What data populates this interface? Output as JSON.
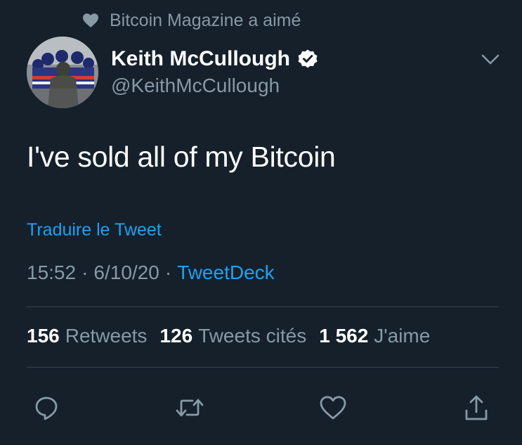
{
  "social_context": {
    "icon": "heart-icon",
    "text": "Bitcoin Magazine a aimé"
  },
  "author": {
    "name": "Keith McCullough",
    "handle": "@KeithMcCullough",
    "verified": true
  },
  "tweet": {
    "text": "I've sold all of my Bitcoin",
    "translate_label": "Traduire le Tweet",
    "time": "15:52",
    "separator": "·",
    "date": "6/10/20",
    "source": "TweetDeck"
  },
  "stats": {
    "retweets": {
      "count": "156",
      "label": "Retweets"
    },
    "quotes": {
      "count": "126",
      "label": "Tweets cités"
    },
    "likes": {
      "count": "1 562",
      "label": "J'aime"
    }
  },
  "actions": [
    "reply-icon",
    "retweet-icon",
    "like-icon",
    "share-icon"
  ],
  "colors": {
    "background": "#15202b",
    "accent": "#1da1f2",
    "secondary_text": "#8899a6",
    "divider": "#38444d"
  }
}
